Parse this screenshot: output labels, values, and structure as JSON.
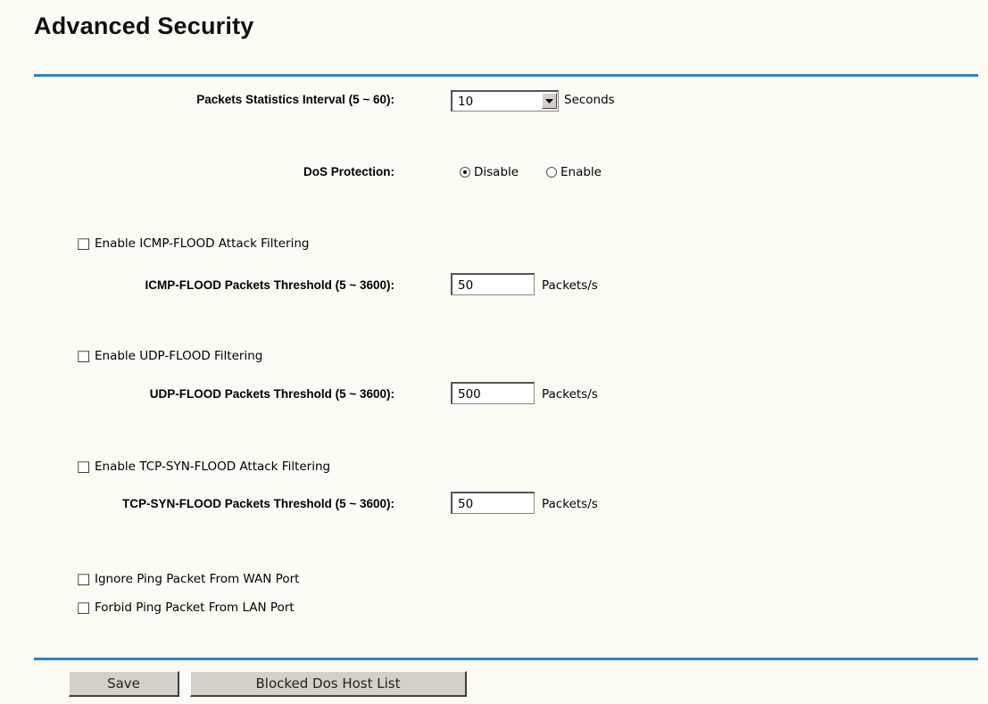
{
  "page": {
    "title": "Advanced Security"
  },
  "stats": {
    "label": "Packets Statistics Interval (5 ~ 60):",
    "value": "10",
    "unit": "Seconds"
  },
  "dos": {
    "label": "DoS Protection:",
    "options": [
      "Disable",
      "Enable"
    ],
    "selected": "Disable"
  },
  "icmp": {
    "enable_label": "Enable ICMP-FLOOD Attack Filtering",
    "enabled": false,
    "threshold_label": "ICMP-FLOOD Packets Threshold (5 ~ 3600):",
    "threshold": "50",
    "unit": "Packets/s"
  },
  "udp": {
    "enable_label": "Enable UDP-FLOOD Filtering",
    "enabled": false,
    "threshold_label": "UDP-FLOOD Packets Threshold (5 ~ 3600):",
    "threshold": "500",
    "unit": "Packets/s"
  },
  "tcp": {
    "enable_label": "Enable TCP-SYN-FLOOD Attack Filtering",
    "enabled": false,
    "threshold_label": "TCP-SYN-FLOOD Packets Threshold (5 ~ 3600):",
    "threshold": "50",
    "unit": "Packets/s"
  },
  "ping": {
    "ignore_wan_label": "Ignore Ping Packet From WAN Port",
    "ignore_wan": false,
    "forbid_lan_label": "Forbid Ping Packet From LAN Port",
    "forbid_lan": false
  },
  "buttons": {
    "save": "Save",
    "blocked_list": "Blocked Dos Host List"
  },
  "colors": {
    "accent": "#2f84c4",
    "background": "#fcfcf5",
    "button": "#d4d0c8"
  }
}
